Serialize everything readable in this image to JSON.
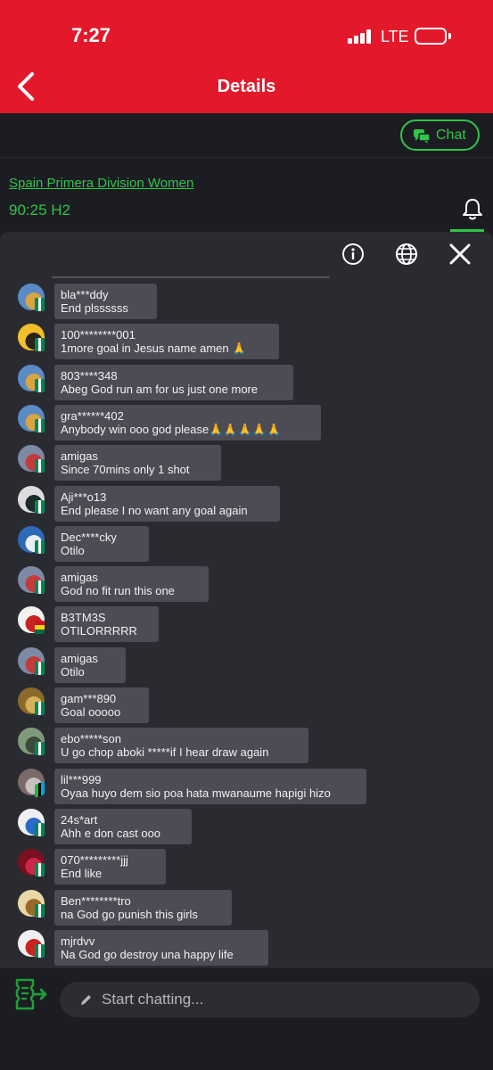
{
  "status_bar": {
    "time": "7:27",
    "network": "LTE"
  },
  "header": {
    "title": "Details"
  },
  "chat_button": {
    "label": "Chat"
  },
  "match": {
    "league": "Spain Primera Division Women",
    "time": "90:25 H2"
  },
  "colors": {
    "brand_red": "#e3192b",
    "accent_green": "#32c34b",
    "bubble": "#4b4c54",
    "panel": "#2a2b31"
  },
  "icons": [
    "back-icon",
    "chat-icon",
    "bell-icon",
    "info-icon",
    "globe-icon",
    "close-icon",
    "bet-slip-icon",
    "pencil-icon"
  ],
  "messages": [
    {
      "user": "bla***ddy",
      "text": "End plssssss"
    },
    {
      "user": "100********001",
      "text": "1more goal in Jesus name amen 🙏"
    },
    {
      "user": "803****348",
      "text": "Abeg God run am for us just one more"
    },
    {
      "user": "gra******402",
      "text": "Anybody win ooo god please🙏🙏🙏🙏🙏"
    },
    {
      "user": "amigas",
      "text": "Since 70mins only 1 shot"
    },
    {
      "user": "Aji***o13",
      "text": "End please I no want any goal again"
    },
    {
      "user": "Dec****cky",
      "text": "Otilo"
    },
    {
      "user": "amigas",
      "text": "God no fit run this one"
    },
    {
      "user": "B3TM3S",
      "text": "OTILORRRRR"
    },
    {
      "user": "amigas",
      "text": "Otilo"
    },
    {
      "user": "gam***890",
      "text": "Goal ooooo"
    },
    {
      "user": "ebo*****son",
      "text": "U go chop aboki *****if I hear draw again"
    },
    {
      "user": "lil***999",
      "text": "Oyaa huyo dem sio poa hata mwanaume hapigi hizo"
    },
    {
      "user": "24s*art",
      "text": "Ahh e don cast ooo"
    },
    {
      "user": "070*********jjj",
      "text": "End like"
    },
    {
      "user": "Ben********tro",
      "text": "na God go punish this girls"
    },
    {
      "user": "mjrdvv",
      "text": "Na God go destroy una happy life"
    }
  ],
  "composer": {
    "placeholder": "Start chatting..."
  }
}
